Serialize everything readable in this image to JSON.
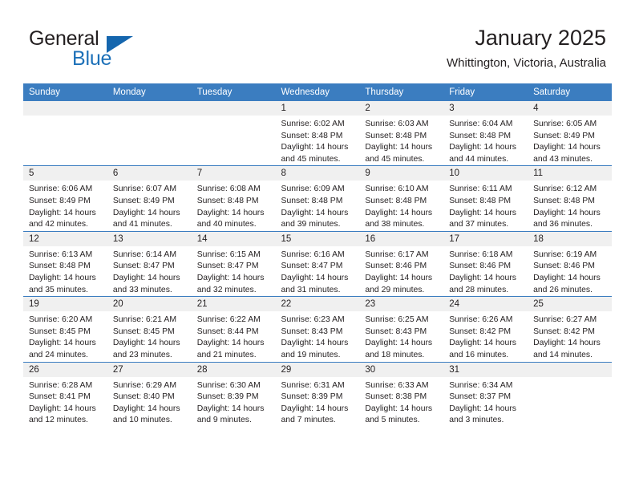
{
  "brand": {
    "name_part1": "General",
    "name_part2": "Blue",
    "triangle_icon": "triangle-icon",
    "accent_color": "#1c70b8"
  },
  "header": {
    "title": "January 2025",
    "subtitle": "Whittington, Victoria, Australia"
  },
  "colors": {
    "header_bar": "#3b7dc0",
    "daynum_band": "#f0f0f0",
    "text": "#231f20"
  },
  "weekdays": [
    "Sunday",
    "Monday",
    "Tuesday",
    "Wednesday",
    "Thursday",
    "Friday",
    "Saturday"
  ],
  "labels": {
    "sunrise_prefix": "Sunrise:",
    "sunset_prefix": "Sunset:",
    "daylight_prefix": "Daylight:"
  },
  "weeks": [
    [
      {
        "day": "",
        "empty": true
      },
      {
        "day": "",
        "empty": true
      },
      {
        "day": "",
        "empty": true
      },
      {
        "day": "1",
        "sunrise": "Sunrise: 6:02 AM",
        "sunset": "Sunset: 8:48 PM",
        "daylight_1": "Daylight: 14 hours",
        "daylight_2": "and 45 minutes."
      },
      {
        "day": "2",
        "sunrise": "Sunrise: 6:03 AM",
        "sunset": "Sunset: 8:48 PM",
        "daylight_1": "Daylight: 14 hours",
        "daylight_2": "and 45 minutes."
      },
      {
        "day": "3",
        "sunrise": "Sunrise: 6:04 AM",
        "sunset": "Sunset: 8:48 PM",
        "daylight_1": "Daylight: 14 hours",
        "daylight_2": "and 44 minutes."
      },
      {
        "day": "4",
        "sunrise": "Sunrise: 6:05 AM",
        "sunset": "Sunset: 8:49 PM",
        "daylight_1": "Daylight: 14 hours",
        "daylight_2": "and 43 minutes."
      }
    ],
    [
      {
        "day": "5",
        "sunrise": "Sunrise: 6:06 AM",
        "sunset": "Sunset: 8:49 PM",
        "daylight_1": "Daylight: 14 hours",
        "daylight_2": "and 42 minutes."
      },
      {
        "day": "6",
        "sunrise": "Sunrise: 6:07 AM",
        "sunset": "Sunset: 8:49 PM",
        "daylight_1": "Daylight: 14 hours",
        "daylight_2": "and 41 minutes."
      },
      {
        "day": "7",
        "sunrise": "Sunrise: 6:08 AM",
        "sunset": "Sunset: 8:48 PM",
        "daylight_1": "Daylight: 14 hours",
        "daylight_2": "and 40 minutes."
      },
      {
        "day": "8",
        "sunrise": "Sunrise: 6:09 AM",
        "sunset": "Sunset: 8:48 PM",
        "daylight_1": "Daylight: 14 hours",
        "daylight_2": "and 39 minutes."
      },
      {
        "day": "9",
        "sunrise": "Sunrise: 6:10 AM",
        "sunset": "Sunset: 8:48 PM",
        "daylight_1": "Daylight: 14 hours",
        "daylight_2": "and 38 minutes."
      },
      {
        "day": "10",
        "sunrise": "Sunrise: 6:11 AM",
        "sunset": "Sunset: 8:48 PM",
        "daylight_1": "Daylight: 14 hours",
        "daylight_2": "and 37 minutes."
      },
      {
        "day": "11",
        "sunrise": "Sunrise: 6:12 AM",
        "sunset": "Sunset: 8:48 PM",
        "daylight_1": "Daylight: 14 hours",
        "daylight_2": "and 36 minutes."
      }
    ],
    [
      {
        "day": "12",
        "sunrise": "Sunrise: 6:13 AM",
        "sunset": "Sunset: 8:48 PM",
        "daylight_1": "Daylight: 14 hours",
        "daylight_2": "and 35 minutes."
      },
      {
        "day": "13",
        "sunrise": "Sunrise: 6:14 AM",
        "sunset": "Sunset: 8:47 PM",
        "daylight_1": "Daylight: 14 hours",
        "daylight_2": "and 33 minutes."
      },
      {
        "day": "14",
        "sunrise": "Sunrise: 6:15 AM",
        "sunset": "Sunset: 8:47 PM",
        "daylight_1": "Daylight: 14 hours",
        "daylight_2": "and 32 minutes."
      },
      {
        "day": "15",
        "sunrise": "Sunrise: 6:16 AM",
        "sunset": "Sunset: 8:47 PM",
        "daylight_1": "Daylight: 14 hours",
        "daylight_2": "and 31 minutes."
      },
      {
        "day": "16",
        "sunrise": "Sunrise: 6:17 AM",
        "sunset": "Sunset: 8:46 PM",
        "daylight_1": "Daylight: 14 hours",
        "daylight_2": "and 29 minutes."
      },
      {
        "day": "17",
        "sunrise": "Sunrise: 6:18 AM",
        "sunset": "Sunset: 8:46 PM",
        "daylight_1": "Daylight: 14 hours",
        "daylight_2": "and 28 minutes."
      },
      {
        "day": "18",
        "sunrise": "Sunrise: 6:19 AM",
        "sunset": "Sunset: 8:46 PM",
        "daylight_1": "Daylight: 14 hours",
        "daylight_2": "and 26 minutes."
      }
    ],
    [
      {
        "day": "19",
        "sunrise": "Sunrise: 6:20 AM",
        "sunset": "Sunset: 8:45 PM",
        "daylight_1": "Daylight: 14 hours",
        "daylight_2": "and 24 minutes."
      },
      {
        "day": "20",
        "sunrise": "Sunrise: 6:21 AM",
        "sunset": "Sunset: 8:45 PM",
        "daylight_1": "Daylight: 14 hours",
        "daylight_2": "and 23 minutes."
      },
      {
        "day": "21",
        "sunrise": "Sunrise: 6:22 AM",
        "sunset": "Sunset: 8:44 PM",
        "daylight_1": "Daylight: 14 hours",
        "daylight_2": "and 21 minutes."
      },
      {
        "day": "22",
        "sunrise": "Sunrise: 6:23 AM",
        "sunset": "Sunset: 8:43 PM",
        "daylight_1": "Daylight: 14 hours",
        "daylight_2": "and 19 minutes."
      },
      {
        "day": "23",
        "sunrise": "Sunrise: 6:25 AM",
        "sunset": "Sunset: 8:43 PM",
        "daylight_1": "Daylight: 14 hours",
        "daylight_2": "and 18 minutes."
      },
      {
        "day": "24",
        "sunrise": "Sunrise: 6:26 AM",
        "sunset": "Sunset: 8:42 PM",
        "daylight_1": "Daylight: 14 hours",
        "daylight_2": "and 16 minutes."
      },
      {
        "day": "25",
        "sunrise": "Sunrise: 6:27 AM",
        "sunset": "Sunset: 8:42 PM",
        "daylight_1": "Daylight: 14 hours",
        "daylight_2": "and 14 minutes."
      }
    ],
    [
      {
        "day": "26",
        "sunrise": "Sunrise: 6:28 AM",
        "sunset": "Sunset: 8:41 PM",
        "daylight_1": "Daylight: 14 hours",
        "daylight_2": "and 12 minutes."
      },
      {
        "day": "27",
        "sunrise": "Sunrise: 6:29 AM",
        "sunset": "Sunset: 8:40 PM",
        "daylight_1": "Daylight: 14 hours",
        "daylight_2": "and 10 minutes."
      },
      {
        "day": "28",
        "sunrise": "Sunrise: 6:30 AM",
        "sunset": "Sunset: 8:39 PM",
        "daylight_1": "Daylight: 14 hours",
        "daylight_2": "and 9 minutes."
      },
      {
        "day": "29",
        "sunrise": "Sunrise: 6:31 AM",
        "sunset": "Sunset: 8:39 PM",
        "daylight_1": "Daylight: 14 hours",
        "daylight_2": "and 7 minutes."
      },
      {
        "day": "30",
        "sunrise": "Sunrise: 6:33 AM",
        "sunset": "Sunset: 8:38 PM",
        "daylight_1": "Daylight: 14 hours",
        "daylight_2": "and 5 minutes."
      },
      {
        "day": "31",
        "sunrise": "Sunrise: 6:34 AM",
        "sunset": "Sunset: 8:37 PM",
        "daylight_1": "Daylight: 14 hours",
        "daylight_2": "and 3 minutes."
      },
      {
        "day": "",
        "empty": true
      }
    ]
  ]
}
